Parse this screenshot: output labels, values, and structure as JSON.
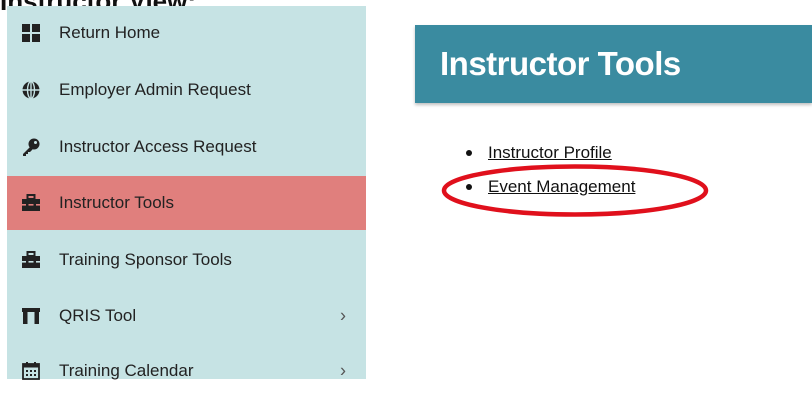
{
  "page_heading": "Instructor View:",
  "sidebar": {
    "items": [
      {
        "label": "Return Home",
        "icon": "grid-icon",
        "active": false,
        "has_submenu": false
      },
      {
        "label": "Employer Admin Request",
        "icon": "globe-icon",
        "active": false,
        "has_submenu": false
      },
      {
        "label": "Instructor Access Request",
        "icon": "key-icon",
        "active": false,
        "has_submenu": false
      },
      {
        "label": "Instructor Tools",
        "icon": "toolbox-icon",
        "active": true,
        "has_submenu": false
      },
      {
        "label": "Training Sponsor Tools",
        "icon": "toolbox-icon",
        "active": false,
        "has_submenu": false
      },
      {
        "label": "QRIS Tool",
        "icon": "arch-icon",
        "active": false,
        "has_submenu": true
      },
      {
        "label": "Training Calendar",
        "icon": "calendar-icon",
        "active": false,
        "has_submenu": true
      }
    ],
    "chevron": "›"
  },
  "main": {
    "header_title": "Instructor Tools",
    "links": [
      {
        "label": "Instructor Profile"
      },
      {
        "label": "Event Management"
      }
    ]
  },
  "colors": {
    "sidebar_bg": "#c6e3e4",
    "active_item_bg": "#e07f7d",
    "header_bg": "#3a8ba0",
    "highlight_ring": "#e0101c"
  }
}
